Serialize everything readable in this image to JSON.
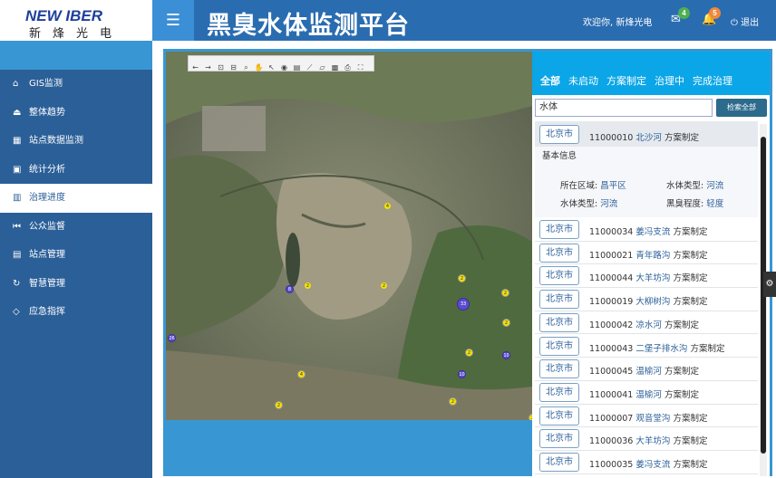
{
  "logo": {
    "line1": "NEW IBER",
    "line2": "新烽光电"
  },
  "header": {
    "title": "黑臭水体监测平台",
    "welcome": "欢迎你, 新烽光电",
    "mail_count": "4",
    "bell_count": "5",
    "logout": "退出"
  },
  "sidebar": {
    "items": [
      {
        "label": "GIS监测",
        "icon": "home-icon",
        "glyph": "⌂"
      },
      {
        "label": "整体趋势",
        "icon": "eject-icon",
        "glyph": "⏏"
      },
      {
        "label": "站点数据监测",
        "icon": "grid-icon",
        "glyph": "▦"
      },
      {
        "label": "统计分析",
        "icon": "save-icon",
        "glyph": "▣"
      },
      {
        "label": "治理进度",
        "icon": "bar-chart-icon",
        "glyph": "▥"
      },
      {
        "label": "公众监督",
        "icon": "rewind-icon",
        "glyph": "⏮"
      },
      {
        "label": "站点管理",
        "icon": "calendar-icon",
        "glyph": "▤"
      },
      {
        "label": "智慧管理",
        "icon": "refresh-icon",
        "glyph": "↻"
      },
      {
        "label": "应急指挥",
        "icon": "leaf-icon",
        "glyph": "◇"
      }
    ]
  },
  "panel": {
    "tabs": [
      "全部",
      "未启动",
      "方案制定",
      "治理中",
      "完成治理"
    ],
    "search_value": "水体",
    "search_button": "检索全部",
    "detail": {
      "city": "北京市",
      "code": "11000010",
      "name": "北沙河",
      "status": "方案制定",
      "basic_label": "基本信息",
      "area_label": "所在区域:",
      "area": "昌平区",
      "type_label": "水体类型:",
      "type": "河流",
      "type_label2": "水体类型:",
      "type2": "河流",
      "level_label": "黑臭程度:",
      "level": "轻度"
    },
    "rows": [
      {
        "city": "北京市",
        "code": "11000034",
        "name": "姜冯支流",
        "status": "方案制定"
      },
      {
        "city": "北京市",
        "code": "11000021",
        "name": "青年路沟",
        "status": "方案制定"
      },
      {
        "city": "北京市",
        "code": "11000044",
        "name": "大羊坊沟",
        "status": "方案制定"
      },
      {
        "city": "北京市",
        "code": "11000019",
        "name": "大柳树沟",
        "status": "方案制定"
      },
      {
        "city": "北京市",
        "code": "11000042",
        "name": "凉水河",
        "status": "方案制定"
      },
      {
        "city": "北京市",
        "code": "11000043",
        "name": "二堡子排水沟",
        "status": "方案制定"
      },
      {
        "city": "北京市",
        "code": "11000045",
        "name": "温榆河",
        "status": "方案制定"
      },
      {
        "city": "北京市",
        "code": "11000041",
        "name": "温榆河",
        "status": "方案制定"
      },
      {
        "city": "北京市",
        "code": "11000007",
        "name": "观音堂沟",
        "status": "方案制定"
      },
      {
        "city": "北京市",
        "code": "11000036",
        "name": "大羊坊沟",
        "status": "方案制定"
      },
      {
        "city": "北京市",
        "code": "11000035",
        "name": "姜冯支流",
        "status": "方案制定"
      }
    ]
  },
  "map": {
    "markers": [
      "4",
      "2",
      "8",
      "2",
      "2",
      "33",
      "2",
      "2",
      "2",
      "4",
      "2",
      "26",
      "10",
      "10",
      "2",
      "2"
    ]
  }
}
